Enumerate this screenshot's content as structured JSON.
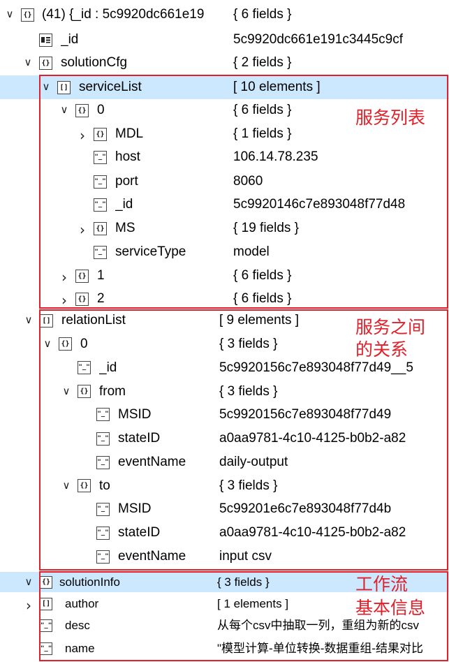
{
  "tree": {
    "rows": [
      {
        "key": "(41) {_id : 5c9920dc661e19",
        "value": "{ 6 fields }",
        "chev": "down",
        "icon": "object"
      },
      {
        "key": "_id",
        "value": "5c9920dc661e191c3445c9cf",
        "chev": "",
        "icon": "idcard"
      },
      {
        "key": "solutionCfg",
        "value": "{ 2 fields }",
        "chev": "down",
        "icon": "object"
      },
      {
        "key": "serviceList",
        "value": "[ 10 elements ]",
        "chev": "down",
        "icon": "array"
      },
      {
        "key": "0",
        "value": "{ 6 fields }",
        "chev": "down",
        "icon": "object"
      },
      {
        "key": "MDL",
        "value": "{ 1 fields }",
        "chev": "right",
        "icon": "object"
      },
      {
        "key": "host",
        "value": "106.14.78.235",
        "chev": "",
        "icon": "string"
      },
      {
        "key": "port",
        "value": "8060",
        "chev": "",
        "icon": "string"
      },
      {
        "key": "_id",
        "value": "5c9920146c7e893048f77d48",
        "chev": "",
        "icon": "string"
      },
      {
        "key": "MS",
        "value": "{ 19 fields }",
        "chev": "right",
        "icon": "object"
      },
      {
        "key": "serviceType",
        "value": "model",
        "chev": "",
        "icon": "string"
      },
      {
        "key": "1",
        "value": "{ 6 fields }",
        "chev": "right",
        "icon": "object"
      },
      {
        "key": "2",
        "value": "{ 6 fields }",
        "chev": "right",
        "icon": "object"
      },
      {
        "key": "relationList",
        "value": "[ 9 elements ]",
        "chev": "down",
        "icon": "array"
      },
      {
        "key": "0",
        "value": "{ 3 fields }",
        "chev": "down",
        "icon": "object"
      },
      {
        "key": "_id",
        "value": "5c9920156c7e893048f77d49__5",
        "chev": "",
        "icon": "string"
      },
      {
        "key": "from",
        "value": "{ 3 fields }",
        "chev": "down",
        "icon": "object"
      },
      {
        "key": "MSID",
        "value": "5c9920156c7e893048f77d49",
        "chev": "",
        "icon": "string"
      },
      {
        "key": "stateID",
        "value": "a0aa9781-4c10-4125-b0b2-a82",
        "chev": "",
        "icon": "string"
      },
      {
        "key": "eventName",
        "value": "daily-output",
        "chev": "",
        "icon": "string"
      },
      {
        "key": "to",
        "value": "{ 3 fields }",
        "chev": "down",
        "icon": "object"
      },
      {
        "key": "MSID",
        "value": "5c99201e6c7e893048f77d4b",
        "chev": "",
        "icon": "string"
      },
      {
        "key": "stateID",
        "value": "a0aa9781-4c10-4125-b0b2-a82",
        "chev": "",
        "icon": "string"
      },
      {
        "key": "eventName",
        "value": "input csv",
        "chev": "",
        "icon": "string"
      },
      {
        "key": "solutionInfo",
        "value": "{ 3 fields }",
        "chev": "down",
        "icon": "object"
      },
      {
        "key": "author",
        "value": "[ 1 elements ]",
        "chev": "right",
        "icon": "array"
      },
      {
        "key": "desc",
        "value": "从每个csv中抽取一列，重组为新的csv",
        "chev": "",
        "icon": "string"
      },
      {
        "key": "name",
        "value": "\"模型计算-单位转换-数据重组-结果对比",
        "chev": "",
        "icon": "string"
      }
    ]
  },
  "icons": {
    "object": "{}",
    "array": "[]",
    "string": "\"_\"",
    "chevron_down": "∨",
    "chevron_right": "›"
  },
  "annotations": {
    "service_list": "服务列表",
    "relation_line1": "服务之间",
    "relation_line2": "的关系",
    "workflow_line1": "工作流",
    "workflow_line2": "基本信息"
  },
  "colors": {
    "selection": "#cce8ff",
    "annotation_red": "#e0202a"
  }
}
